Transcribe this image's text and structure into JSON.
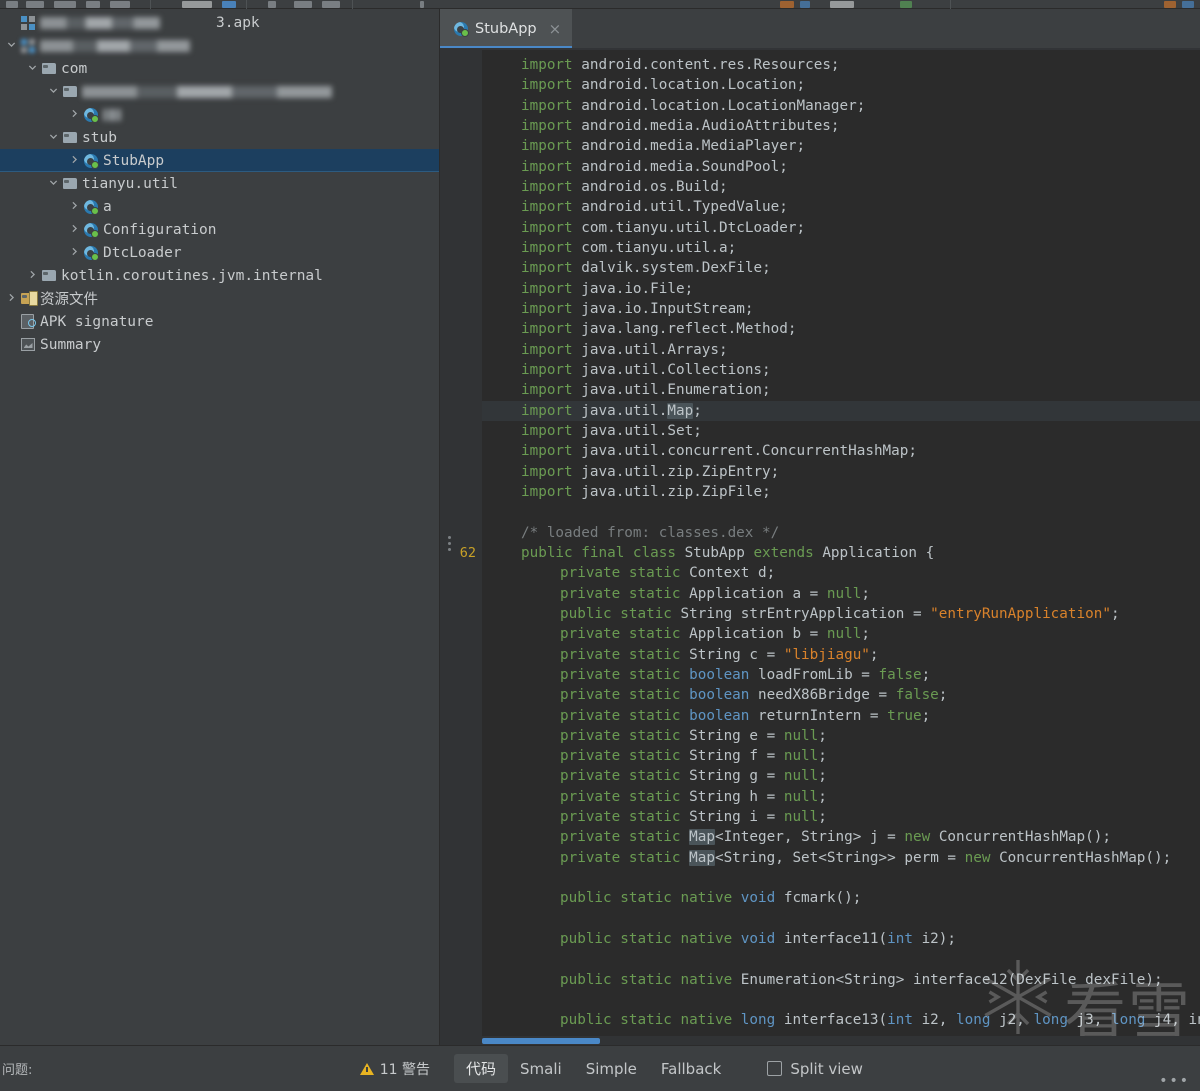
{
  "window": {
    "theme_bg": "#3c3f41",
    "editor_bg": "#2b2b2b",
    "accent": "#4a88c7",
    "selection_bg": "#1c3f5f"
  },
  "tree": {
    "items": [
      {
        "label": "3.apk",
        "icon": "apk-archive-icon",
        "indent": 0,
        "arrow": "none",
        "redacted_prefix": true,
        "selected": false
      },
      {
        "label": "",
        "icon": "archive-icon",
        "indent": 0,
        "arrow": "down",
        "redacted_full": true,
        "selected": false
      },
      {
        "label": "com",
        "icon": "folder-icon",
        "indent": 1,
        "arrow": "down",
        "selected": false
      },
      {
        "label": "",
        "icon": "folder-icon",
        "indent": 2,
        "arrow": "down",
        "redacted_full": true,
        "selected": false
      },
      {
        "label": "",
        "icon": "class-icon",
        "indent": 3,
        "arrow": "right",
        "redacted_full": true,
        "selected": false
      },
      {
        "label": "stub",
        "icon": "folder-icon",
        "indent": 2,
        "arrow": "down",
        "selected": false
      },
      {
        "label": "StubApp",
        "icon": "class-icon",
        "indent": 3,
        "arrow": "right",
        "selected": true
      },
      {
        "label": "tianyu.util",
        "icon": "folder-icon",
        "indent": 2,
        "arrow": "down",
        "selected": false
      },
      {
        "label": "a",
        "icon": "class-icon",
        "indent": 3,
        "arrow": "right",
        "selected": false
      },
      {
        "label": "Configuration",
        "icon": "class-icon",
        "indent": 3,
        "arrow": "right",
        "selected": false
      },
      {
        "label": "DtcLoader",
        "icon": "class-icon",
        "indent": 3,
        "arrow": "right",
        "selected": false
      },
      {
        "label": "kotlin.coroutines.jvm.internal",
        "icon": "folder-icon",
        "indent": 1,
        "arrow": "right",
        "selected": false
      },
      {
        "label": "资源文件",
        "icon": "resource-folder-icon",
        "indent": 0,
        "arrow": "right",
        "selected": false
      },
      {
        "label": "APK signature",
        "icon": "signature-icon",
        "indent": 0,
        "arrow": "none",
        "selected": false
      },
      {
        "label": "Summary",
        "icon": "summary-icon",
        "indent": 0,
        "arrow": "none",
        "selected": false
      }
    ]
  },
  "tab": {
    "label": "StubApp",
    "icon": "class-icon",
    "close_glyph": "×"
  },
  "editor": {
    "gutter_line_number": "62",
    "lines": [
      {
        "t": "import",
        "rest": " android.content.res.Resources;"
      },
      {
        "t": "import",
        "rest": " android.location.Location;"
      },
      {
        "t": "import",
        "rest": " android.location.LocationManager;"
      },
      {
        "t": "import",
        "rest": " android.media.AudioAttributes;"
      },
      {
        "t": "import",
        "rest": " android.media.MediaPlayer;"
      },
      {
        "t": "import",
        "rest": " android.media.SoundPool;"
      },
      {
        "t": "import",
        "rest": " android.os.Build;"
      },
      {
        "t": "import",
        "rest": " android.util.TypedValue;"
      },
      {
        "t": "import",
        "rest": " com.tianyu.util.DtcLoader;"
      },
      {
        "t": "import",
        "rest": " com.tianyu.util.a;"
      },
      {
        "t": "import",
        "rest": " dalvik.system.DexFile;"
      },
      {
        "t": "import",
        "rest": " java.io.File;"
      },
      {
        "t": "import",
        "rest": " java.io.InputStream;"
      },
      {
        "t": "import",
        "rest": " java.lang.reflect.Method;"
      },
      {
        "t": "import",
        "rest": " java.util.Arrays;"
      },
      {
        "t": "import",
        "rest": " java.util.Collections;"
      },
      {
        "t": "import",
        "rest": " java.util.Enumeration;"
      },
      {
        "t": "import",
        "rest": " java.util.Map;",
        "highlight": "Map",
        "current": true
      },
      {
        "t": "import",
        "rest": " java.util.Set;"
      },
      {
        "t": "import",
        "rest": " java.util.concurrent.ConcurrentHashMap;"
      },
      {
        "t": "import",
        "rest": " java.util.zip.ZipEntry;"
      },
      {
        "t": "import",
        "rest": " java.util.zip.ZipFile;"
      }
    ],
    "comment": "/* loaded from: classes.dex */",
    "class_decl": "public final class StubApp extends Application {",
    "fields": [
      "private static Context d;",
      "private static Application a = null;",
      "public static String strEntryApplication = \"entryRunApplication\";",
      "private static Application b = null;",
      "private static String c = \"libjiagu\";",
      "private static boolean loadFromLib = false;",
      "private static boolean needX86Bridge = false;",
      "private static boolean returnIntern = true;",
      "private static String e = null;",
      "private static String f = null;",
      "private static String g = null;",
      "private static String h = null;",
      "private static String i = null;",
      "private static Map<Integer, String> j = new ConcurrentHashMap();",
      "private static Map<String, Set<String>> perm = new ConcurrentHashMap();"
    ],
    "methods": [
      "public static native void fcmark();",
      "public static native void interface11(int i2);",
      "public static native Enumeration<String> interface12(DexFile dexFile);",
      "public static native long interface13(int i2, long j2, long j3, long j4, in"
    ],
    "watermark_text": "看雪"
  },
  "status": {
    "problems_label": "问题:",
    "warning_count": "11 警告",
    "warning_icon": "warning-triangle-icon"
  },
  "viewbar": {
    "tabs": [
      {
        "label": "代码",
        "active": true
      },
      {
        "label": "Smali",
        "active": false
      },
      {
        "label": "Simple",
        "active": false
      },
      {
        "label": "Fallback",
        "active": false
      }
    ],
    "split_view_label": "Split view",
    "split_view_checked": false,
    "overflow_glyph": "•••"
  }
}
